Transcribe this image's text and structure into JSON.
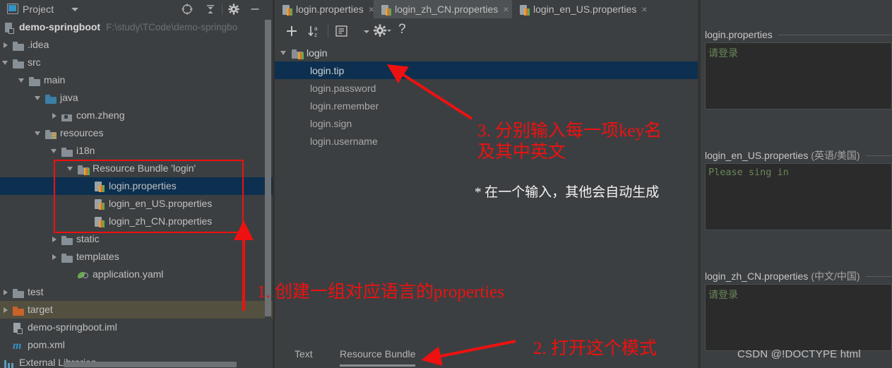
{
  "project_panel": {
    "header": {
      "title": "Project",
      "icons": [
        "project-view-icon",
        "caret-down-icon",
        "locate-target-icon",
        "collapse-all-icon",
        "settings-gear-icon",
        "hide-minimize-icon"
      ]
    },
    "tree": [
      {
        "label": "demo-springboot",
        "path": "F:\\study\\TCode\\demo-springbo",
        "icon": "module-icon",
        "indent": 6,
        "arrow": "none",
        "style": "root"
      },
      {
        "label": ".idea",
        "icon": "folder-icon",
        "indent": 18,
        "arrow": "right"
      },
      {
        "label": "src",
        "icon": "folder-icon",
        "indent": 18,
        "arrow": "down"
      },
      {
        "label": "main",
        "icon": "folder-icon",
        "indent": 41,
        "arrow": "down"
      },
      {
        "label": "java",
        "icon": "source-folder-icon",
        "indent": 64,
        "arrow": "down"
      },
      {
        "label": "com.zheng",
        "icon": "package-icon",
        "indent": 87,
        "arrow": "right"
      },
      {
        "label": "resources",
        "icon": "resources-folder-icon",
        "indent": 64,
        "arrow": "down"
      },
      {
        "label": "i18n",
        "icon": "folder-icon",
        "indent": 87,
        "arrow": "down"
      },
      {
        "label": "Resource Bundle 'login'",
        "icon": "resource-bundle-icon",
        "indent": 110,
        "arrow": "down"
      },
      {
        "label": "login.properties",
        "icon": "properties-file-icon",
        "indent": 133,
        "arrow": "none",
        "selected": true
      },
      {
        "label": "login_en_US.properties",
        "icon": "properties-file-icon",
        "indent": 133,
        "arrow": "none"
      },
      {
        "label": "login_zh_CN.properties",
        "icon": "properties-file-icon",
        "indent": 133,
        "arrow": "none"
      },
      {
        "label": "static",
        "icon": "folder-icon",
        "indent": 87,
        "arrow": "right"
      },
      {
        "label": "templates",
        "icon": "folder-icon",
        "indent": 87,
        "arrow": "right"
      },
      {
        "label": "application.yaml",
        "icon": "yaml-file-icon",
        "indent": 110,
        "arrow": "none"
      },
      {
        "label": "test",
        "icon": "folder-icon",
        "indent": 18,
        "arrow": "right"
      },
      {
        "label": "target",
        "icon": "folder-excluded-icon",
        "indent": 18,
        "arrow": "right",
        "highlight": true
      },
      {
        "label": "demo-springboot.iml",
        "icon": "iml-file-icon",
        "indent": 18,
        "arrow": "none"
      },
      {
        "label": "pom.xml",
        "icon": "maven-file-icon",
        "indent": 18,
        "arrow": "none"
      },
      {
        "label": "External Libraries",
        "icon": "libraries-icon",
        "indent": 6,
        "arrow": "none"
      }
    ]
  },
  "editor": {
    "tabs": [
      {
        "label": "login.properties",
        "icon": "properties-file-icon",
        "active": false,
        "close": "×"
      },
      {
        "label": "login_zh_CN.properties",
        "icon": "properties-file-icon",
        "active": true,
        "close": "×"
      },
      {
        "label": "login_en_US.properties",
        "icon": "properties-file-icon",
        "active": false,
        "close": "×"
      }
    ],
    "toolbar": [
      {
        "name": "add-property-button",
        "glyph": "+"
      },
      {
        "name": "sort-alphabetically-button",
        "glyph": "↓az"
      },
      {
        "name": "group-by-button",
        "glyph": "list-icon"
      },
      {
        "name": "expand-options-button",
        "glyph": "▾"
      },
      {
        "name": "settings-gear-button",
        "glyph": "gear-icon"
      },
      {
        "name": "help-button",
        "glyph": "?"
      }
    ],
    "bundle_tree": {
      "root": {
        "label": "login",
        "icon": "resource-bundle-icon"
      },
      "keys": [
        {
          "label": "login.tip",
          "selected": true
        },
        {
          "label": "login.password",
          "selected": false
        },
        {
          "label": "login.remember",
          "selected": false
        },
        {
          "label": "login.sign",
          "selected": false
        },
        {
          "label": "login.username",
          "selected": false
        }
      ]
    },
    "bottom_tabs": [
      {
        "label": "Text",
        "active": false
      },
      {
        "label": "Resource Bundle",
        "active": true
      }
    ]
  },
  "values_panel": {
    "groups": [
      {
        "file": "login.properties",
        "locale": "",
        "value": "请登录",
        "cjk": true
      },
      {
        "file": "login_en_US.properties",
        "locale": "(英语/美国)",
        "value": "Please sing in",
        "cjk": false
      },
      {
        "file": "login_zh_CN.properties",
        "locale": "(中文/中国)",
        "value": "请登录",
        "cjk": true
      }
    ]
  },
  "annotations": {
    "step1": "1. 创建一组对应语言的properties",
    "step2": "2. 打开这个模式",
    "step3_line1": "3. 分别输入每一项key名",
    "step3_line2": "及其中英文",
    "note": "* 在一个输入，其他会自动生成"
  },
  "watermark": "CSDN @!DOCTYPE html",
  "colors": {
    "bg": "#3c3f41",
    "selection": "#0d3050",
    "annotation_red": "#ee1111",
    "editor_bg": "#2b2b2b",
    "value_green": "#6a8759",
    "target_highlight": "#53503f"
  }
}
